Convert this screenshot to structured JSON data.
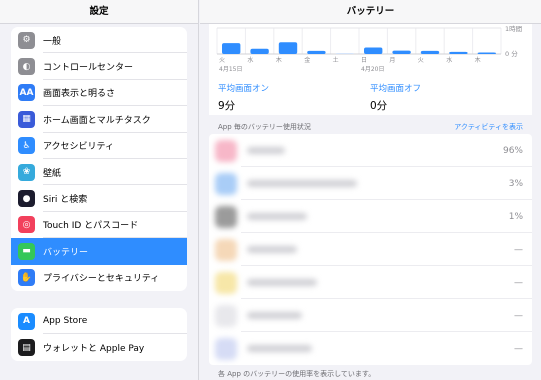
{
  "settings": {
    "title": "設定",
    "group1": [
      {
        "label": "一般",
        "icon": "gear-icon",
        "color": "#8e8e93",
        "glyph": "⚙"
      },
      {
        "label": "コントロールセンター",
        "icon": "control-center-icon",
        "color": "#8e8e93",
        "glyph": "◐"
      },
      {
        "label": "画面表示と明るさ",
        "icon": "display-brightness-icon",
        "color": "#2f7cf6",
        "glyph": "AA"
      },
      {
        "label": "ホーム画面とマルチタスク",
        "icon": "home-screen-icon",
        "color": "#3a5bd9",
        "glyph": "▦"
      },
      {
        "label": "アクセシビリティ",
        "icon": "accessibility-icon",
        "color": "#2f8dff",
        "glyph": "♿"
      },
      {
        "label": "壁紙",
        "icon": "wallpaper-icon",
        "color": "#35aadc",
        "glyph": "❀"
      },
      {
        "label": "Siri と検索",
        "icon": "siri-icon",
        "color": "#1c1c2e",
        "glyph": "●"
      },
      {
        "label": "Touch ID とパスコード",
        "icon": "fingerprint-icon",
        "color": "#f2405c",
        "glyph": "◎"
      },
      {
        "label": "バッテリー",
        "icon": "battery-icon",
        "color": "#34c759",
        "glyph": "▬",
        "selected": true
      },
      {
        "label": "プライバシーとセキュリティ",
        "icon": "hand-icon",
        "color": "#2f7cf6",
        "glyph": "✋"
      }
    ],
    "group2": [
      {
        "label": "App Store",
        "icon": "app-store-icon",
        "color": "#1a8cff",
        "glyph": "A"
      },
      {
        "label": "ウォレットと Apple Pay",
        "icon": "wallet-icon",
        "color": "#1c1c1e",
        "glyph": "▤"
      }
    ]
  },
  "battery": {
    "title": "バッテリー",
    "chart": {
      "ytop": "1時間",
      "ybottom": "0 分",
      "day_labels": [
        "火",
        "水",
        "木",
        "金",
        "土",
        "日",
        "月",
        "火",
        "水",
        "木"
      ],
      "date_label_1": "4月15日",
      "date_label_2": "4月20日",
      "accent": "#2f8dff"
    },
    "screen_on_label": "平均画面オン",
    "screen_on_value": "9分",
    "screen_off_label": "平均画面オフ",
    "screen_off_value": "0分",
    "usage_header": "App 毎のバッテリー使用状況",
    "activity_link": "アクティビティを表示",
    "app_rows": [
      {
        "pct": "96%",
        "color": "#f7b7c8",
        "w": 38
      },
      {
        "pct": "3%",
        "color": "#a9cdf7",
        "w": 110
      },
      {
        "pct": "1%",
        "color": "#9b9b9b",
        "w": 60
      },
      {
        "pct": "—",
        "color": "#f5d8b8",
        "w": 50
      },
      {
        "pct": "—",
        "color": "#f7e7a8",
        "w": 70
      },
      {
        "pct": "—",
        "color": "#e8e8ec",
        "w": 55
      },
      {
        "pct": "—",
        "color": "#d6dcf5",
        "w": 65
      }
    ],
    "footer_note": "各 App のバッテリーの使用率を表示しています。"
  }
}
